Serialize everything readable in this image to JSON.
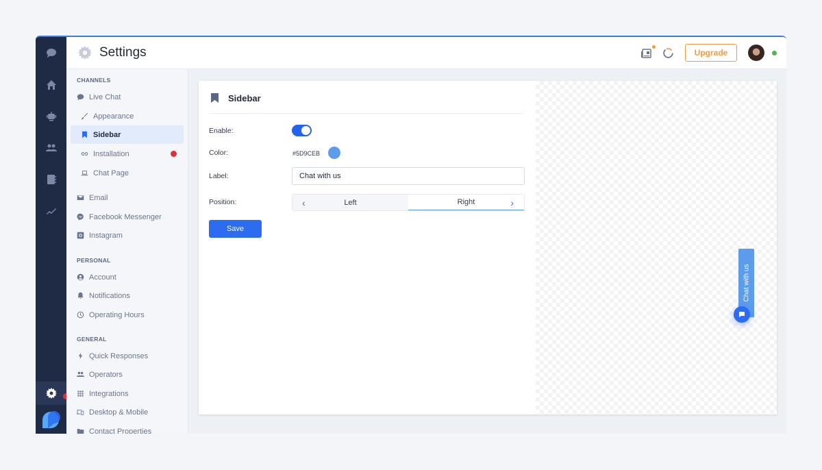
{
  "header": {
    "title": "Settings",
    "upgrade_label": "Upgrade",
    "icons": [
      "news-icon",
      "progress-ring-icon",
      "avatar",
      "online-status"
    ]
  },
  "rail": {
    "items": [
      "chat-icon",
      "home-icon",
      "bot-icon",
      "users-icon",
      "contacts-icon",
      "analytics-icon",
      "settings-icon"
    ]
  },
  "sidenav": {
    "sections": [
      {
        "title": "CHANNELS",
        "items": [
          {
            "label": "Live Chat",
            "icon": "chat-icon"
          },
          {
            "label": "Appearance",
            "icon": "brush-icon"
          },
          {
            "label": "Sidebar",
            "icon": "bookmark-icon",
            "active": true
          },
          {
            "label": "Installation",
            "icon": "link-icon",
            "alert": true
          },
          {
            "label": "Chat Page",
            "icon": "laptop-icon"
          },
          {
            "label": "Email",
            "icon": "mail-icon"
          },
          {
            "label": "Facebook Messenger",
            "icon": "messenger-icon"
          },
          {
            "label": "Instagram",
            "icon": "instagram-icon"
          }
        ]
      },
      {
        "title": "PERSONAL",
        "items": [
          {
            "label": "Account",
            "icon": "account-icon"
          },
          {
            "label": "Notifications",
            "icon": "bell-icon"
          },
          {
            "label": "Operating Hours",
            "icon": "clock-icon"
          }
        ]
      },
      {
        "title": "GENERAL",
        "items": [
          {
            "label": "Quick Responses",
            "icon": "bolt-icon"
          },
          {
            "label": "Operators",
            "icon": "users-icon"
          },
          {
            "label": "Integrations",
            "icon": "grid-icon"
          },
          {
            "label": "Desktop & Mobile",
            "icon": "devices-icon"
          },
          {
            "label": "Contact Properties",
            "icon": "folder-icon"
          }
        ]
      }
    ]
  },
  "form": {
    "title": "Sidebar",
    "enable_label": "Enable:",
    "enabled": true,
    "color_label": "Color:",
    "color_value": "#5D9CEB",
    "label_label": "Label:",
    "label_value": "Chat with us",
    "position_label": "Position:",
    "position_options": [
      "Left",
      "Right"
    ],
    "position_selected": "Right",
    "save_label": "Save"
  },
  "preview": {
    "tab_label": "Chat with us",
    "accent": "#5D9CEB"
  }
}
